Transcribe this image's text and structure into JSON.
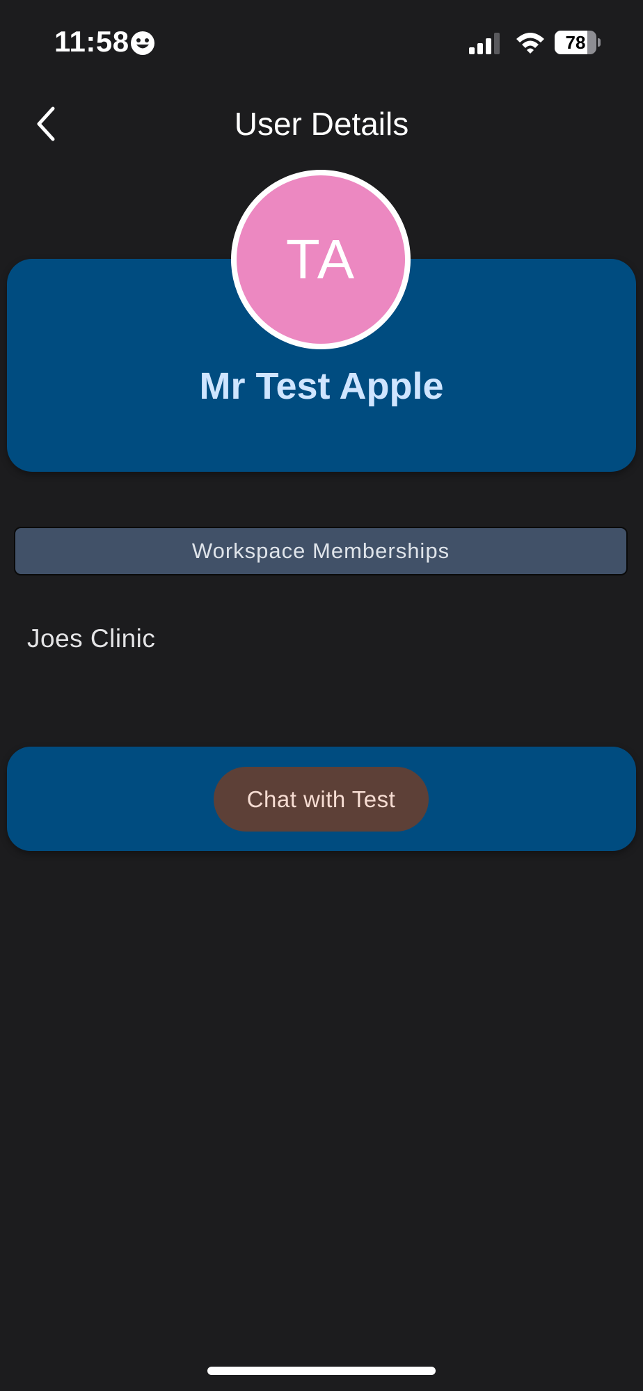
{
  "status_bar": {
    "time": "11:58",
    "battery_level": "78",
    "battery_fraction": 0.78
  },
  "header": {
    "title": "User Details",
    "back_icon": "chevron-left-icon"
  },
  "profile": {
    "initials": "TA",
    "name": "Mr Test Apple",
    "avatar_color": "#ec88c1",
    "card_color": "#004c80"
  },
  "workspace": {
    "header_label": "Workspace Memberships",
    "items": [
      "Joes Clinic"
    ]
  },
  "actions": {
    "chat_label": "Chat with Test",
    "button_color": "#5d4037"
  }
}
